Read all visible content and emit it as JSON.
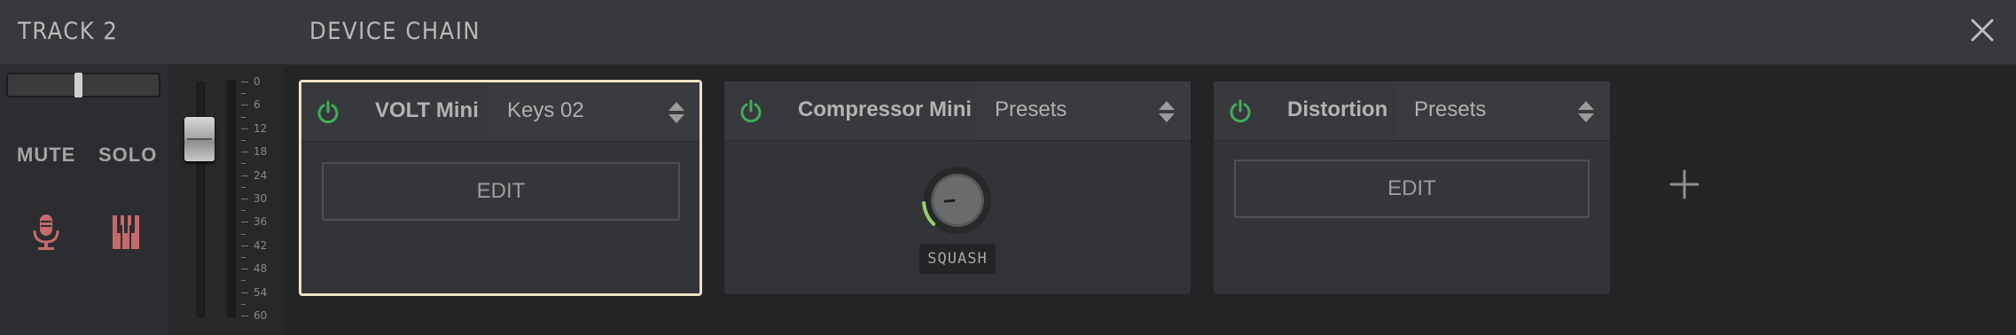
{
  "track": {
    "title": "TRACK 2",
    "mute_label": "MUTE",
    "solo_label": "SOLO",
    "meter_ticks": [
      "0",
      "6",
      "12",
      "18",
      "24",
      "30",
      "36",
      "42",
      "48",
      "54",
      "60"
    ],
    "pan_position": 0.5,
    "fader_level": 0.82
  },
  "chain": {
    "title": "DEVICE CHAIN",
    "close_icon": "close-icon",
    "add_icon": "plus-icon"
  },
  "devices": [
    {
      "name": "VOLT Mini",
      "preset": "Keys 02",
      "edit_label": "EDIT",
      "power_on": true,
      "selected": true
    },
    {
      "name": "Compressor Mini",
      "preset": "Presets",
      "knob_label": "SQUASH",
      "knob_value": 0.15,
      "power_on": true,
      "selected": false
    },
    {
      "name": "Distortion",
      "preset": "Presets",
      "edit_label": "EDIT",
      "power_on": true,
      "selected": false
    }
  ],
  "colors": {
    "power_on": "#3fae5a",
    "selected_border": "#ece3c4",
    "icon_red": "#c46a6a",
    "knob_arc": "#8fd36a"
  }
}
